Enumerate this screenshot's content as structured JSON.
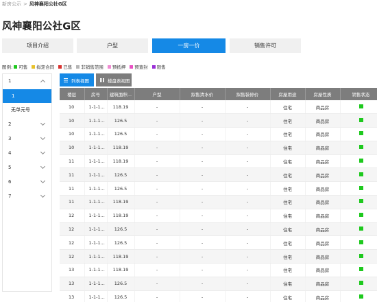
{
  "breadcrumb": {
    "parent": "新房公示",
    "separator": ">",
    "current": "风神襄阳公社G区"
  },
  "page_title": "风神襄阳公社G区",
  "tabs": [
    {
      "label": "项目介绍",
      "active": false
    },
    {
      "label": "户型",
      "active": false
    },
    {
      "label": "一房一价",
      "active": true
    },
    {
      "label": "销售许可",
      "active": false
    }
  ],
  "legend": {
    "label": "图例:",
    "items": [
      {
        "label": "可售",
        "color": "#1ec91e"
      },
      {
        "label": "拟定合同",
        "color": "#e8c22a"
      },
      {
        "label": "已售",
        "color": "#d9322f"
      },
      {
        "label": "非销售范围",
        "color": "#b5b5b5"
      },
      {
        "label": "预抵押",
        "color": "#f08ad2"
      },
      {
        "label": "预查封",
        "color": "#e84fc3"
      },
      {
        "label": "限售",
        "color": "#9a2fd6"
      }
    ]
  },
  "sidebar": {
    "buildings": [
      {
        "label": "1",
        "expanded": true,
        "units": [
          {
            "label": "1",
            "selected": true
          },
          {
            "label": "无单元号",
            "selected": false
          }
        ]
      },
      {
        "label": "2",
        "expanded": false
      },
      {
        "label": "3",
        "expanded": false
      },
      {
        "label": "4",
        "expanded": false
      },
      {
        "label": "5",
        "expanded": false
      },
      {
        "label": "6",
        "expanded": false
      },
      {
        "label": "7",
        "expanded": false
      }
    ]
  },
  "view_buttons": {
    "list": "列表视图",
    "grid": "楼盘表视图"
  },
  "table": {
    "columns": [
      "楼层",
      "房号",
      "建筑面积...",
      "户型",
      "拟售清水价",
      "拟售装修价",
      "房屋用途",
      "房屋性质",
      "销售状态"
    ],
    "rows": [
      {
        "floor": "10",
        "room": "1-1-1...",
        "area": "118.19",
        "layout": "-",
        "plain_price": "-",
        "deco_price": "-",
        "usage": "住宅",
        "nature": "商品房",
        "status": "可售"
      },
      {
        "floor": "10",
        "room": "1-1-1...",
        "area": "126.5",
        "layout": "-",
        "plain_price": "-",
        "deco_price": "-",
        "usage": "住宅",
        "nature": "商品房",
        "status": "可售"
      },
      {
        "floor": "10",
        "room": "1-1-1...",
        "area": "126.5",
        "layout": "-",
        "plain_price": "-",
        "deco_price": "-",
        "usage": "住宅",
        "nature": "商品房",
        "status": "可售"
      },
      {
        "floor": "10",
        "room": "1-1-1...",
        "area": "118.19",
        "layout": "-",
        "plain_price": "-",
        "deco_price": "-",
        "usage": "住宅",
        "nature": "商品房",
        "status": "可售"
      },
      {
        "floor": "11",
        "room": "1-1-1...",
        "area": "118.19",
        "layout": "-",
        "plain_price": "-",
        "deco_price": "-",
        "usage": "住宅",
        "nature": "商品房",
        "status": "可售"
      },
      {
        "floor": "11",
        "room": "1-1-1...",
        "area": "126.5",
        "layout": "-",
        "plain_price": "-",
        "deco_price": "-",
        "usage": "住宅",
        "nature": "商品房",
        "status": "可售"
      },
      {
        "floor": "11",
        "room": "1-1-1...",
        "area": "126.5",
        "layout": "-",
        "plain_price": "-",
        "deco_price": "-",
        "usage": "住宅",
        "nature": "商品房",
        "status": "可售"
      },
      {
        "floor": "11",
        "room": "1-1-1...",
        "area": "118.19",
        "layout": "-",
        "plain_price": "-",
        "deco_price": "-",
        "usage": "住宅",
        "nature": "商品房",
        "status": "可售"
      },
      {
        "floor": "12",
        "room": "1-1-1...",
        "area": "118.19",
        "layout": "-",
        "plain_price": "-",
        "deco_price": "-",
        "usage": "住宅",
        "nature": "商品房",
        "status": "可售"
      },
      {
        "floor": "12",
        "room": "1-1-1...",
        "area": "126.5",
        "layout": "-",
        "plain_price": "-",
        "deco_price": "-",
        "usage": "住宅",
        "nature": "商品房",
        "status": "可售"
      },
      {
        "floor": "12",
        "room": "1-1-1...",
        "area": "126.5",
        "layout": "-",
        "plain_price": "-",
        "deco_price": "-",
        "usage": "住宅",
        "nature": "商品房",
        "status": "可售"
      },
      {
        "floor": "12",
        "room": "1-1-1...",
        "area": "118.19",
        "layout": "-",
        "plain_price": "-",
        "deco_price": "-",
        "usage": "住宅",
        "nature": "商品房",
        "status": "可售"
      },
      {
        "floor": "13",
        "room": "1-1-1...",
        "area": "118.19",
        "layout": "-",
        "plain_price": "-",
        "deco_price": "-",
        "usage": "住宅",
        "nature": "商品房",
        "status": "可售"
      },
      {
        "floor": "13",
        "room": "1-1-1...",
        "area": "126.5",
        "layout": "-",
        "plain_price": "-",
        "deco_price": "-",
        "usage": "住宅",
        "nature": "商品房",
        "status": "可售"
      },
      {
        "floor": "13",
        "room": "1-1-1...",
        "area": "126.5",
        "layout": "-",
        "plain_price": "-",
        "deco_price": "-",
        "usage": "住宅",
        "nature": "商品房",
        "status": "可售"
      }
    ]
  }
}
